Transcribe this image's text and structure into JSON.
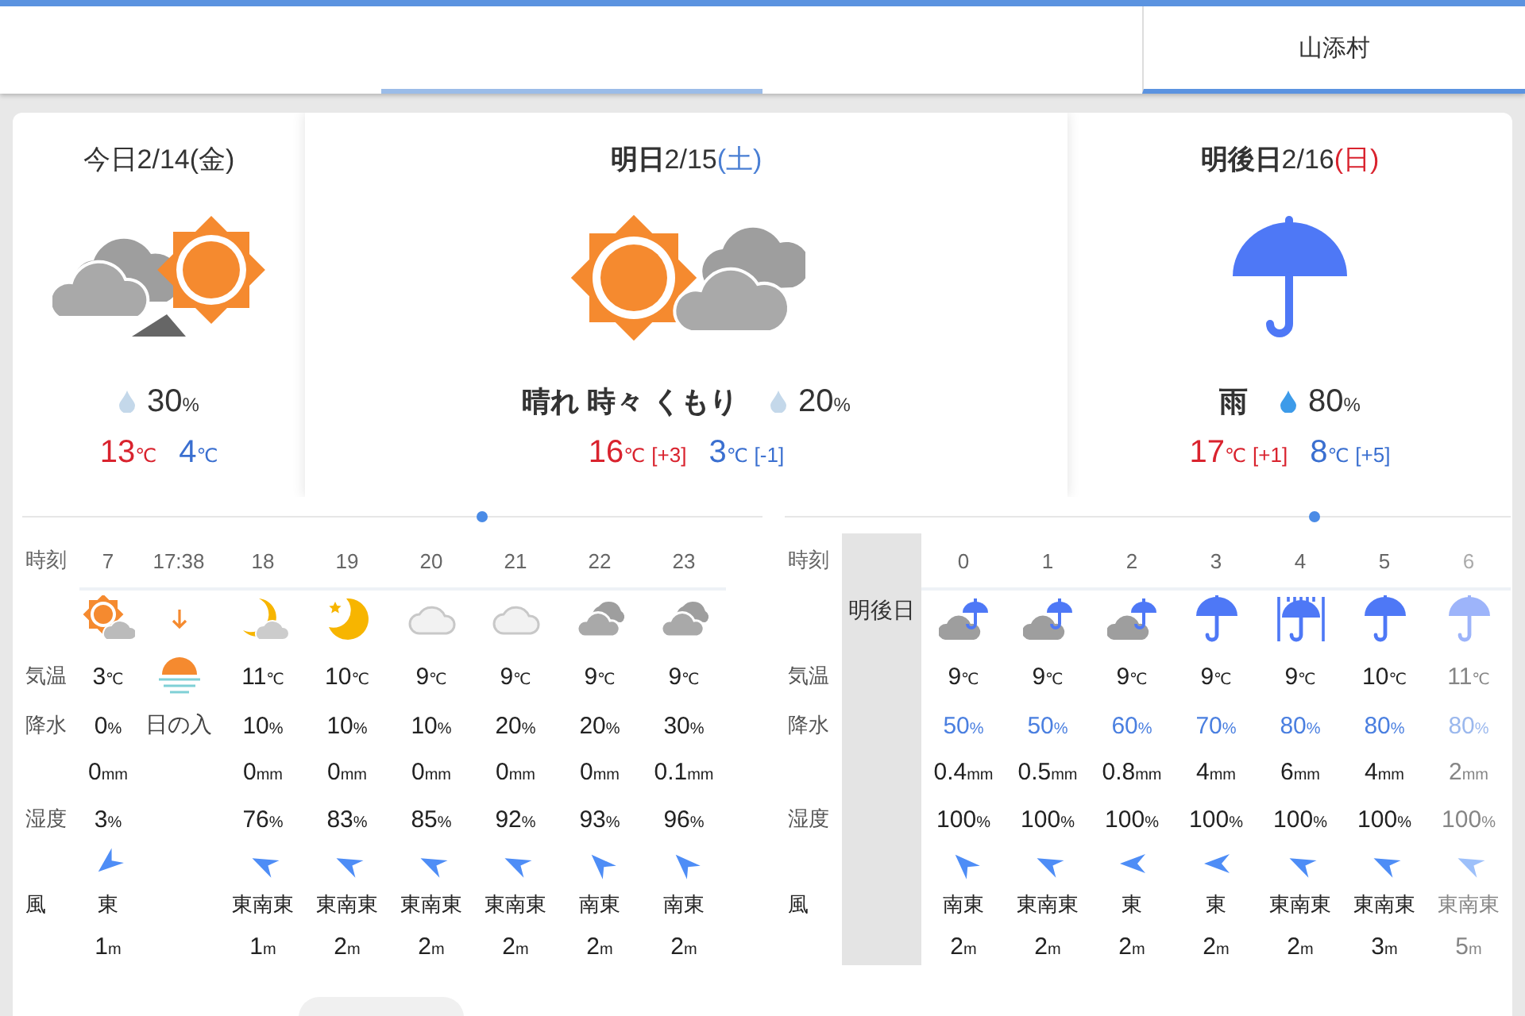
{
  "tabs": [
    {
      "selected": false,
      "highlighted": false
    },
    {
      "selected": false,
      "highlighted": true
    },
    {
      "selected": false,
      "highlighted": false
    },
    {
      "label": "山添村",
      "selected": true,
      "highlighted": false
    }
  ],
  "days": [
    {
      "kind": "cloud-then-sun",
      "title": "今日2/14",
      "weekday": {
        "text": "(金)"
      },
      "pop": "30%",
      "pop_heavy": false,
      "high": "13℃",
      "low": "4℃"
    },
    {
      "kind": "sun-then-cloud",
      "title": "**明日**2/15",
      "weekday": {
        "text": "(土)",
        "color": "#4a7fd4"
      },
      "weather": "晴れ 時々 くもり",
      "pop": "20%",
      "pop_heavy": false,
      "high": "16℃",
      "high_diff": "[+3]",
      "low": "3℃",
      "low_diff": "[-1]"
    },
    {
      "kind": "rain",
      "title": "**明後日**2/16",
      "weekday": {
        "text": "(日)",
        "color": "#d9232e"
      },
      "weather": "雨",
      "pop": "80%",
      "pop_heavy": true,
      "high": "17℃",
      "high_diff": "[+1]",
      "low": "8℃",
      "low_diff": "[+5]"
    }
  ],
  "hourly": [
    {
      "row_labels": {
        "time": "時刻",
        "temp": "気温",
        "pop": "降水",
        "humidity": "湿度",
        "wind": "風"
      },
      "columns": [
        {
          "kind": "sun-cloud",
          "faded": false,
          "time": "7",
          "temp": "3℃",
          "pop": "0%",
          "rain": false,
          "amount": "0mm",
          "humidity": "3%",
          "wind": {
            "kind": "sw",
            "direction": "東",
            "speed": "1m"
          }
        },
        {
          "kind": "sunset",
          "time": "17:38",
          "label": "日の入"
        },
        {
          "kind": "moon-cloud",
          "faded": false,
          "time": "18",
          "temp": "11℃",
          "pop": "10%",
          "rain": false,
          "amount": "0mm",
          "humidity": "76%",
          "wind": {
            "kind": "wnw",
            "direction": "東南東",
            "speed": "1m"
          }
        },
        {
          "kind": "moon",
          "faded": false,
          "time": "19",
          "temp": "10℃",
          "pop": "10%",
          "rain": false,
          "amount": "0mm",
          "humidity": "83%",
          "wind": {
            "kind": "wnw",
            "direction": "東南東",
            "speed": "2m"
          }
        },
        {
          "kind": "cloud",
          "faded": false,
          "time": "20",
          "temp": "9℃",
          "pop": "10%",
          "rain": false,
          "amount": "0mm",
          "humidity": "85%",
          "wind": {
            "kind": "wnw",
            "direction": "東南東",
            "speed": "2m"
          }
        },
        {
          "kind": "cloud",
          "faded": false,
          "time": "21",
          "temp": "9℃",
          "pop": "20%",
          "rain": false,
          "amount": "0mm",
          "humidity": "92%",
          "wind": {
            "kind": "wnw",
            "direction": "東南東",
            "speed": "2m"
          }
        },
        {
          "kind": "clouds",
          "faded": false,
          "time": "22",
          "temp": "9℃",
          "pop": "20%",
          "rain": false,
          "amount": "0mm",
          "humidity": "93%",
          "wind": {
            "kind": "nw",
            "direction": "南東",
            "speed": "2m"
          }
        },
        {
          "kind": "clouds",
          "faded": false,
          "time": "23",
          "temp": "9℃",
          "pop": "30%",
          "rain": false,
          "amount": "0.1mm",
          "humidity": "96%",
          "wind": {
            "kind": "nw",
            "direction": "南東",
            "speed": "2m"
          }
        }
      ]
    },
    {
      "row_labels": {
        "time": "時刻",
        "temp": "気温",
        "pop": "降水",
        "humidity": "湿度",
        "wind": "風"
      },
      "day_label": "明後日",
      "columns": [
        {
          "kind": "cloud-rain",
          "faded": false,
          "time": "0",
          "temp": "9℃",
          "pop": "50%",
          "rain": true,
          "amount": "0.4mm",
          "humidity": "100%",
          "wind": {
            "kind": "nw",
            "direction": "南東",
            "speed": "2m"
          }
        },
        {
          "kind": "cloud-rain",
          "faded": false,
          "time": "1",
          "temp": "9℃",
          "pop": "50%",
          "rain": true,
          "amount": "0.5mm",
          "humidity": "100%",
          "wind": {
            "kind": "wnw",
            "direction": "東南東",
            "speed": "2m"
          }
        },
        {
          "kind": "cloud-rain",
          "faded": false,
          "time": "2",
          "temp": "9℃",
          "pop": "60%",
          "rain": true,
          "amount": "0.8mm",
          "humidity": "100%",
          "wind": {
            "kind": "w",
            "direction": "東",
            "speed": "2m"
          }
        },
        {
          "kind": "rain",
          "faded": false,
          "time": "3",
          "temp": "9℃",
          "pop": "70%",
          "rain": true,
          "amount": "4mm",
          "humidity": "100%",
          "wind": {
            "kind": "w",
            "direction": "東",
            "speed": "2m"
          }
        },
        {
          "kind": "heavy-rain",
          "faded": false,
          "time": "4",
          "temp": "9℃",
          "pop": "80%",
          "rain": true,
          "amount": "6mm",
          "humidity": "100%",
          "wind": {
            "kind": "wnw",
            "direction": "東南東",
            "speed": "2m"
          }
        },
        {
          "kind": "rain",
          "faded": false,
          "time": "5",
          "temp": "10℃",
          "pop": "80%",
          "rain": true,
          "amount": "4mm",
          "humidity": "100%",
          "wind": {
            "kind": "wnw",
            "direction": "東南東",
            "speed": "3m"
          }
        },
        {
          "kind": "rain",
          "faded": true,
          "time": "6",
          "temp": "11℃",
          "pop": "80%",
          "rain": true,
          "amount": "2mm",
          "humidity": "100%",
          "wind": {
            "kind": "wnw",
            "direction": "東南東",
            "speed": "5m"
          }
        }
      ]
    }
  ]
}
